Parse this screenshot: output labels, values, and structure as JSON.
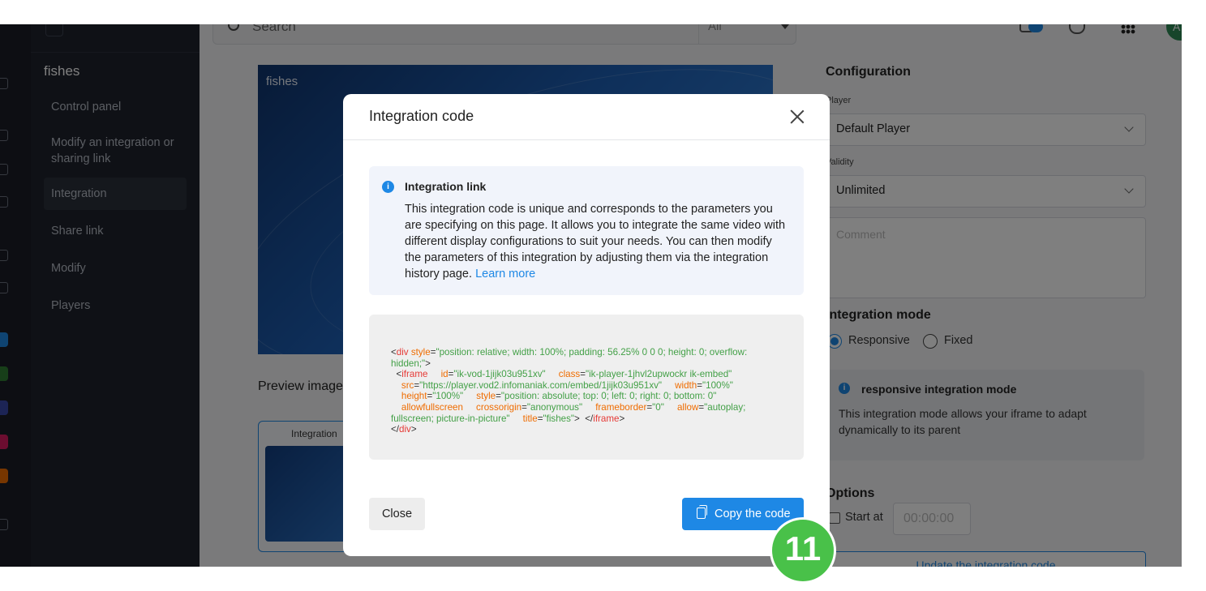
{
  "search": {
    "placeholder": "Search",
    "filter": "All"
  },
  "user": {
    "initials": "A"
  },
  "sidebar": {
    "title": "fishes",
    "items": [
      {
        "label": "Control panel"
      },
      {
        "label": "Modify an integration or sharing link"
      },
      {
        "label": "Integration"
      },
      {
        "label": "Share link"
      },
      {
        "label": "Modify"
      },
      {
        "label": "Players"
      }
    ]
  },
  "preview": {
    "video_title": "fishes",
    "images_heading": "Preview image",
    "thumb_label": "Integration"
  },
  "config": {
    "heading": "Configuration",
    "player_label": "Player",
    "player_value": "Default Player",
    "validity_label": "Validity",
    "validity_value": "Unlimited",
    "comment_placeholder": "Comment",
    "mode_heading": "Integration mode",
    "mode_options": [
      "Responsive",
      "Fixed"
    ],
    "mode_selected": "Responsive",
    "mode_info_title": "responsive integration mode",
    "mode_info_text": "This integration mode allows your iframe to adapt dynamically to its parent",
    "options_heading": "Options",
    "start_at_label": "Start at",
    "start_at_value": "00:00:00",
    "update_button": "Update the integration code"
  },
  "modal": {
    "title": "Integration code",
    "info_title": "Integration link",
    "info_text": "This integration code is unique and corresponds to the parameters you are specifying on this page. It allows you to integrate the same video with different display configurations to suit your needs. You can then modify the parameters of this integration by adjusting them via the integration history page.",
    "info_link": "Learn more",
    "code": {
      "div_style": "position: relative; width: 100%; padding: 56.25% 0 0 0; height: 0; overflow: hidden;",
      "iframe_id": "ik-vod-1jijk03u951xv",
      "iframe_class": "ik-player-1jhvl2upwockr ik-embed",
      "iframe_src": "https://player.vod2.infomaniak.com/embed/1jijk03u951xv",
      "iframe_width": "100%",
      "iframe_height": "100%",
      "iframe_style": "position: absolute; top: 0; left: 0; right: 0; bottom: 0",
      "allowfullscreen": "allowfullscreen",
      "crossorigin": "anonymous",
      "frameborder": "0",
      "allow": "autoplay; fullscreen; picture-in-picture",
      "title": "fishes"
    },
    "close_button": "Close",
    "copy_button": "Copy the code"
  },
  "step_badge": "11",
  "colors": {
    "accent": "#1e88e5",
    "sidebar_bg": "#1f232d",
    "badge_green": "#49c149",
    "code_tag": "#e53935",
    "code_attr": "#ef6c00",
    "code_value": "#43a047"
  }
}
